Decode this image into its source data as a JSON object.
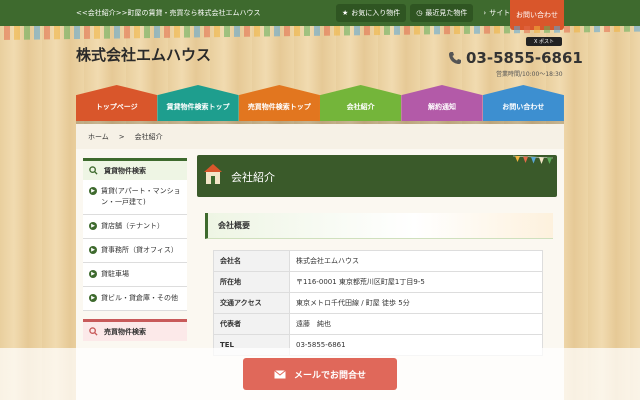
{
  "topbar": {
    "tagline": "<<会社紹介>>町屋の賃貸・売買なら株式会社エムハウス",
    "favorites": "お気に入り物件",
    "recent": "最近見た物件",
    "sitemap": "サイトマップ",
    "contact_tab": "お問い合わせ"
  },
  "header": {
    "site_title": "株式会社エムハウス",
    "social_label": "X ポスト",
    "phone": "03-5855-6861",
    "hours": "営業時間/10:00～18:30"
  },
  "nav": [
    {
      "label": "トップページ",
      "color": "#d9562b"
    },
    {
      "label": "賃貸物件検索トップ",
      "color": "#1e9e8e"
    },
    {
      "label": "売買物件検索トップ",
      "color": "#e2761f"
    },
    {
      "label": "会社紹介",
      "color": "#74b53a"
    },
    {
      "label": "解約通知",
      "color": "#b35aa8"
    },
    {
      "label": "お問い合わせ",
      "color": "#3d8fd0"
    }
  ],
  "breadcrumb": {
    "home": "ホーム",
    "sep": ">",
    "current": "会社紹介"
  },
  "sidebar": {
    "rent_heading": "賃貸物件検索",
    "rent_items": [
      "賃貸(アパート・マンション・一戸建て)",
      "貸店舗（テナント）",
      "貸事務所（貸オフィス）",
      "貸駐車場",
      "貸ビル・貸倉庫・その他"
    ],
    "sale_heading": "売買物件検索"
  },
  "content": {
    "page_title": "会社紹介",
    "section_title": "会社概要",
    "rows": [
      {
        "key": "会社名",
        "value": "株式会社エムハウス"
      },
      {
        "key": "所在地",
        "value": "〒116-0001 東京都荒川区町屋1丁目9-5"
      },
      {
        "key": "交通アクセス",
        "value": "東京メトロ千代田線 / 町屋 徒歩 5分"
      },
      {
        "key": "代表者",
        "value": "遠藤　純也"
      },
      {
        "key": "TEL",
        "value": "03-5855-6861"
      }
    ]
  },
  "mail_button": "メールでお問合せ",
  "colors": {
    "brand_green": "#3e6a2e",
    "accent_orange": "#d9562b",
    "mail_button": "#e0685a"
  }
}
